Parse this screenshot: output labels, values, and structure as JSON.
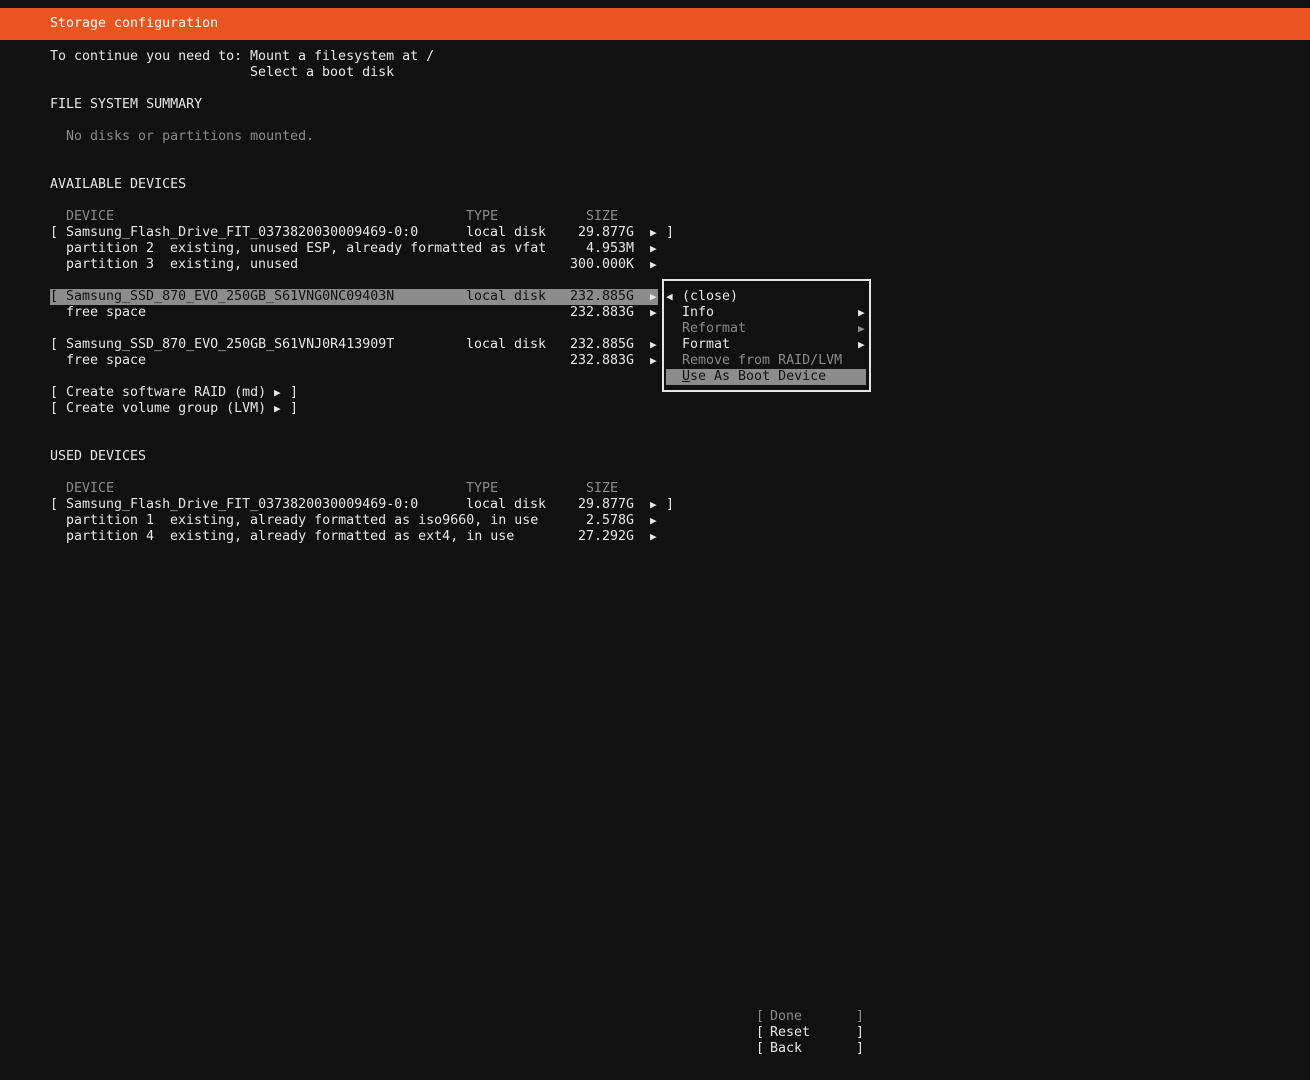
{
  "header": {
    "title": "Storage configuration"
  },
  "requirements": {
    "label": "To continue you need to:",
    "items": [
      "Mount a filesystem at /",
      "Select a boot disk"
    ]
  },
  "fs_summary": {
    "heading": "FILE SYSTEM SUMMARY",
    "empty_text": "No disks or partitions mounted."
  },
  "available": {
    "heading": "AVAILABLE DEVICES",
    "col_device": "DEVICE",
    "col_type": "TYPE",
    "col_size": "SIZE",
    "disks": [
      {
        "name": "Samsung_Flash_Drive_FIT_0373820030009469-0:0",
        "type": "local disk",
        "size": "29.877G",
        "rows": [
          {
            "name": "partition 2",
            "desc": "existing, unused ESP, already formatted as vfat",
            "size": "4.953M"
          },
          {
            "name": "partition 3",
            "desc": "existing, unused",
            "size": "300.000K"
          }
        ]
      },
      {
        "name": "Samsung_SSD_870_EVO_250GB_S61VNG0NC09403N",
        "type": "local disk",
        "size": "232.885G",
        "rows": [
          {
            "name": "free space",
            "size": "232.883G"
          }
        ]
      },
      {
        "name": "Samsung_SSD_870_EVO_250GB_S61VNJ0R413909T",
        "type": "local disk",
        "size": "232.885G",
        "rows": [
          {
            "name": "free space",
            "size": "232.883G"
          }
        ]
      }
    ],
    "create_raid": "Create software RAID (md)",
    "create_lvm": "Create volume group (LVM)"
  },
  "used": {
    "heading": "USED DEVICES",
    "col_device": "DEVICE",
    "col_type": "TYPE",
    "col_size": "SIZE",
    "disk": {
      "name": "Samsung_Flash_Drive_FIT_0373820030009469-0:0",
      "type": "local disk",
      "size": "29.877G",
      "rows": [
        {
          "name": "partition 1",
          "desc": "existing, already formatted as iso9660, in use",
          "size": "2.578G"
        },
        {
          "name": "partition 4",
          "desc": "existing, already formatted as ext4, in use",
          "size": "27.292G"
        }
      ]
    }
  },
  "menu": {
    "close": "(close)",
    "info": "Info",
    "reformat": "Reformat",
    "format": "Format",
    "remove_raid": "Remove from RAID/LVM",
    "boot_hotkey": "U",
    "boot_rest": "se As Boot Device"
  },
  "buttons": {
    "done": "Done",
    "reset": "Reset",
    "back": "Back"
  },
  "icons": {
    "arrow_right": "▶",
    "arrow_left": "◀"
  },
  "colors": {
    "accent": "#e95420",
    "background": "#111111",
    "selection": "#8c8c8c",
    "disabled": "#8a8a8a"
  }
}
